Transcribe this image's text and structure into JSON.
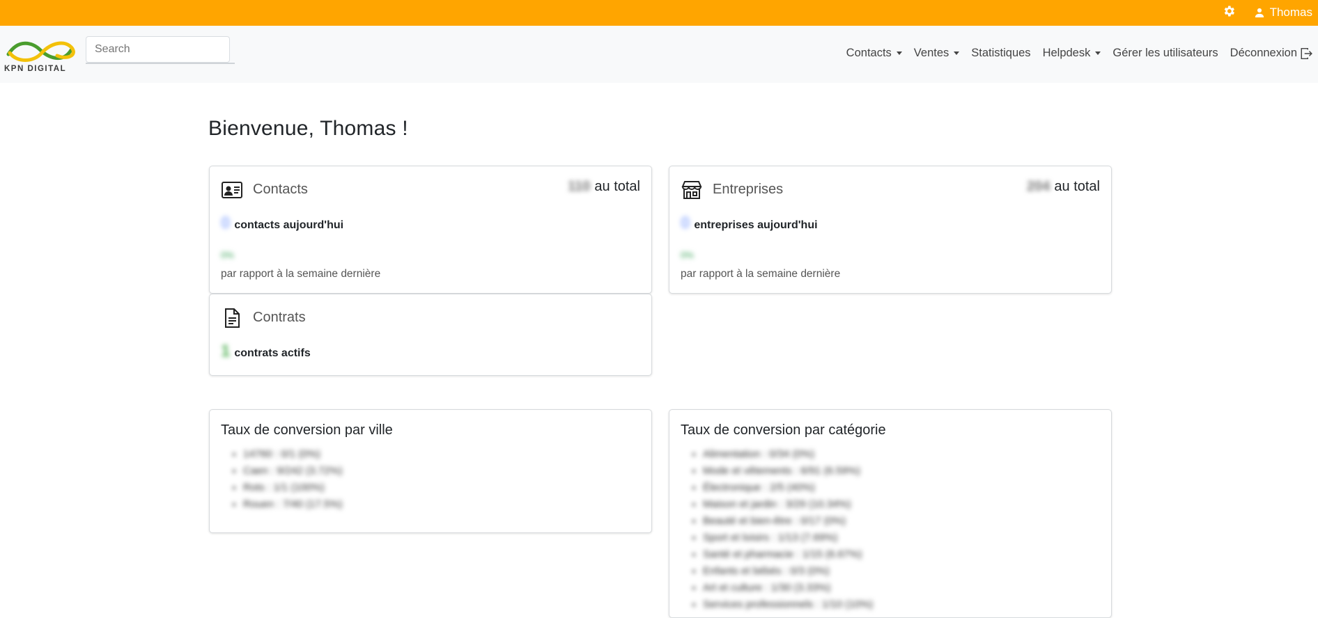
{
  "topbar": {
    "user_name": "Thomas",
    "settings_icon": "gear-icon",
    "user_icon": "person-icon",
    "color": "#FFA500"
  },
  "brand": {
    "name": "KPN DIGITAL"
  },
  "search": {
    "placeholder": "Search"
  },
  "nav": {
    "items": [
      {
        "label": "Contacts",
        "dropdown": true
      },
      {
        "label": "Ventes",
        "dropdown": true
      },
      {
        "label": "Statistiques",
        "dropdown": false
      },
      {
        "label": "Helpdesk",
        "dropdown": true
      },
      {
        "label": "Gérer les utilisateurs",
        "dropdown": false
      },
      {
        "label": "Déconnexion",
        "dropdown": false
      }
    ]
  },
  "welcome": "Bienvenue, Thomas !",
  "cards": {
    "contacts": {
      "title": "Contacts",
      "total_value": "110",
      "total_suffix": "au total",
      "today_value": "0",
      "today_label": "contacts aujourd'hui",
      "pct": "0%",
      "compare": "par rapport à la semaine dernière"
    },
    "entreprises": {
      "title": "Entreprises",
      "total_value": "204",
      "total_suffix": "au total",
      "today_value": "0",
      "today_label": "entreprises aujourd'hui",
      "pct": "0%",
      "compare": "par rapport à la semaine dernière"
    },
    "contrats": {
      "title": "Contrats",
      "active_value": "1",
      "active_label": "contrats actifs"
    }
  },
  "conversion_ville": {
    "title": "Taux de conversion par ville",
    "items": [
      "14760 : 0/1 (0%)",
      "Caen : 9/242 (3.72%)",
      "Rots : 1/1 (100%)",
      "Rouen : 7/40 (17.5%)"
    ]
  },
  "conversion_categorie": {
    "title": "Taux de conversion par catégorie",
    "items": [
      "Alimentation : 0/34 (0%)",
      "Mode et vêtements : 6/91 (6.59%)",
      "Électronique : 2/5 (40%)",
      "Maison et jardin : 3/29 (10.34%)",
      "Beauté et bien-être : 0/17 (0%)",
      "Sport et loisirs : 1/13 (7.69%)",
      "Santé et pharmacie : 1/15 (6.67%)",
      "Enfants et bébés : 0/3 (0%)",
      "Art et culture : 1/30 (3.33%)",
      "Services professionnels : 1/10 (10%)"
    ]
  }
}
